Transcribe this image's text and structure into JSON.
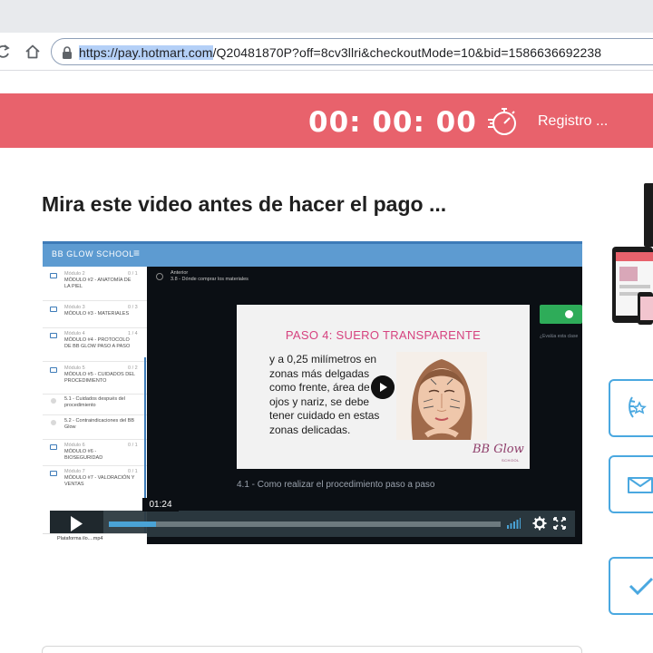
{
  "browser": {
    "url_selected": "https://pay.hotmart.com",
    "url_rest": "/Q20481870P?off=8cv3llri&checkoutMode=10&bid=1586636692238"
  },
  "banner": {
    "timer": "00: 00: 00",
    "register_label": "Registro ...",
    "color": "#e8626c"
  },
  "headline": "Mira este video antes de hacer el pago ...",
  "video": {
    "brand": "BB GLOW SCHOOL",
    "menu_glyph": "≡",
    "sidebar": [
      {
        "module": "Módulo 2",
        "title": "MÓDULO #2 - ANATOMÍA DE LA PIEL",
        "count": "0 / 1",
        "icon": "folder-icon"
      },
      {
        "module": "Módulo 3",
        "title": "MÓDULO #3 - MATERIALES",
        "count": "0 / 3",
        "icon": "folder-icon"
      },
      {
        "module": "Módulo 4",
        "title": "MÓDULO #4 - PROTOCOLO DE BB GLOW PASO A PASO",
        "count": "1 / 4",
        "icon": "folder-icon"
      },
      {
        "module": "Módulo 5",
        "title": "MÓDULO #5 - CUIDADOS DEL PROCEDIMIENTO",
        "count": "0 / 2",
        "icon": "folder-icon"
      },
      {
        "module": "",
        "title": "5.1 - Cuidados después del procedimiento",
        "count": "",
        "icon": "circle-icon"
      },
      {
        "module": "",
        "title": "5.2 - Contraindicaciones del BB Glow",
        "count": "",
        "icon": "circle-icon"
      },
      {
        "module": "Módulo 6",
        "title": "MÓDULO #6 - BIOSEGURIDAD",
        "count": "0 / 1",
        "icon": "folder-icon"
      },
      {
        "module": "Módulo 7",
        "title": "MÓDULO #7 - VALORACIÓN Y VENTAS",
        "count": "0 / 1",
        "icon": "folder-icon"
      }
    ],
    "breadcrumb_prev": "Anterior",
    "breadcrumb_title": "3.8 - Dónde comprar los materiales",
    "side_note": "¿Evalúa esta clase",
    "slide": {
      "title": "PASO 4: SUERO TRANSPARENTE",
      "text": "y a 0,25 milímetros en zonas más delgadas como frente, área de los ojos y nariz, se debe tener cuidado en estas zonas delicadas.",
      "logo_text": "BB Glow",
      "logo_sub": "SCHOOL"
    },
    "lesson_title": "4.1 - Como realizar el procedimiento paso a paso",
    "time": "01:24",
    "progress": 0.12,
    "footer_file": "Plataforma ilo....mp4",
    "accent": "#4aa3d6"
  },
  "right_buttons": [
    "laurel-icon",
    "envelope-icon",
    "check-icon"
  ]
}
